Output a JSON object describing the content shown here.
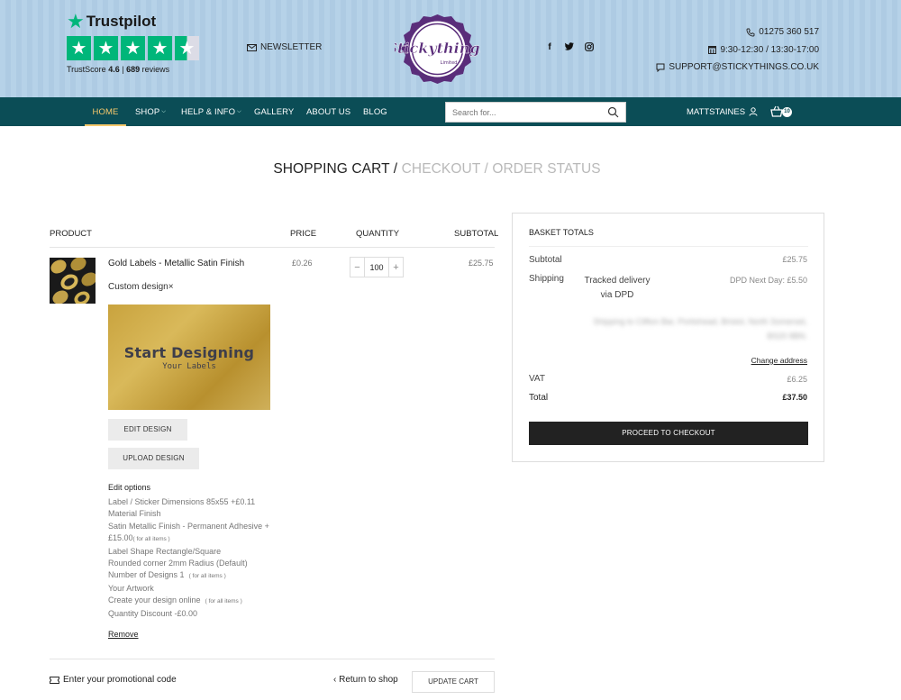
{
  "header": {
    "trustpilot": {
      "brand": "Trustpilot",
      "score_label": "TrustScore",
      "score": "4.6",
      "separator": "|",
      "reviews": "689",
      "reviews_label": "reviews"
    },
    "newsletter": "NEWSLETTER",
    "logo_text": "Stickythings",
    "logo_sub": "Limited",
    "socials": [
      "facebook-icon",
      "twitter-icon",
      "instagram-icon"
    ],
    "phone": "01275 360 517",
    "hours": "9:30-12:30 / 13:30-17:00",
    "email": "SUPPORT@STICKYTHINGS.CO.UK"
  },
  "nav": {
    "items": [
      {
        "label": "HOME"
      },
      {
        "label": "SHOP"
      },
      {
        "label": "HELP & INFO"
      },
      {
        "label": "GALLERY"
      },
      {
        "label": "ABOUT US"
      },
      {
        "label": "BLOG"
      }
    ],
    "search_placeholder": "Search for...",
    "user": "MATTSTAINES",
    "cart_count": "10"
  },
  "breadcrumb": {
    "current": "SHOPPING CART /",
    "checkout": "CHECKOUT /",
    "status": "ORDER STATUS"
  },
  "cart": {
    "columns": {
      "product": "PRODUCT",
      "price": "PRICE",
      "quantity": "QUANTITY",
      "subtotal": "SUBTOTAL"
    },
    "item": {
      "name": "Gold Labels - Metallic Satin Finish",
      "custom": "Custom design×",
      "price": "£0.26",
      "quantity": "100",
      "subtotal": "£25.75",
      "design_title": "Start Designing",
      "design_sub": "Your Labels",
      "edit_design": "EDIT DESIGN",
      "upload_design": "UPLOAD DESIGN",
      "options_title": "Edit options",
      "options": {
        "dimensions": "Label / Sticker Dimensions  85x55  +£0.11",
        "material": "Material Finish",
        "finish": "Satin Metallic Finish - Permanent Adhesive  + £15.00",
        "for_all_1": "( for all items )",
        "shape": "Label Shape  Rectangle/Square",
        "corner": "Rounded corner  2mm Radius (Default)",
        "designs": "Number of Designs  1",
        "for_all_2": "( for all items )",
        "artwork": "Your Artwork",
        "create": "Create your design online",
        "for_all_3": "( for all items )",
        "discount": "Quantity Discount  -£0.00"
      },
      "remove": "Remove"
    },
    "promo": "Enter your promotional code",
    "return": "Return to shop",
    "update": "UPDATE CART"
  },
  "totals": {
    "title": "BASKET TOTALS",
    "subtotal_label": "Subtotal",
    "subtotal": "£25.75",
    "shipping_label": "Shipping",
    "shipping_method": "Tracked delivery via DPD",
    "shipping_value": "DPD Next Day: £5.50",
    "shipping_address": "Shipping to Clifton Bar, Portishead, Bristol, North Somerset, BS20 8BN.",
    "change_address": "Change address",
    "vat_label": "VAT",
    "vat": "£6.25",
    "total_label": "Total",
    "total": "£37.50",
    "checkout": "PROCEED TO CHECKOUT"
  }
}
